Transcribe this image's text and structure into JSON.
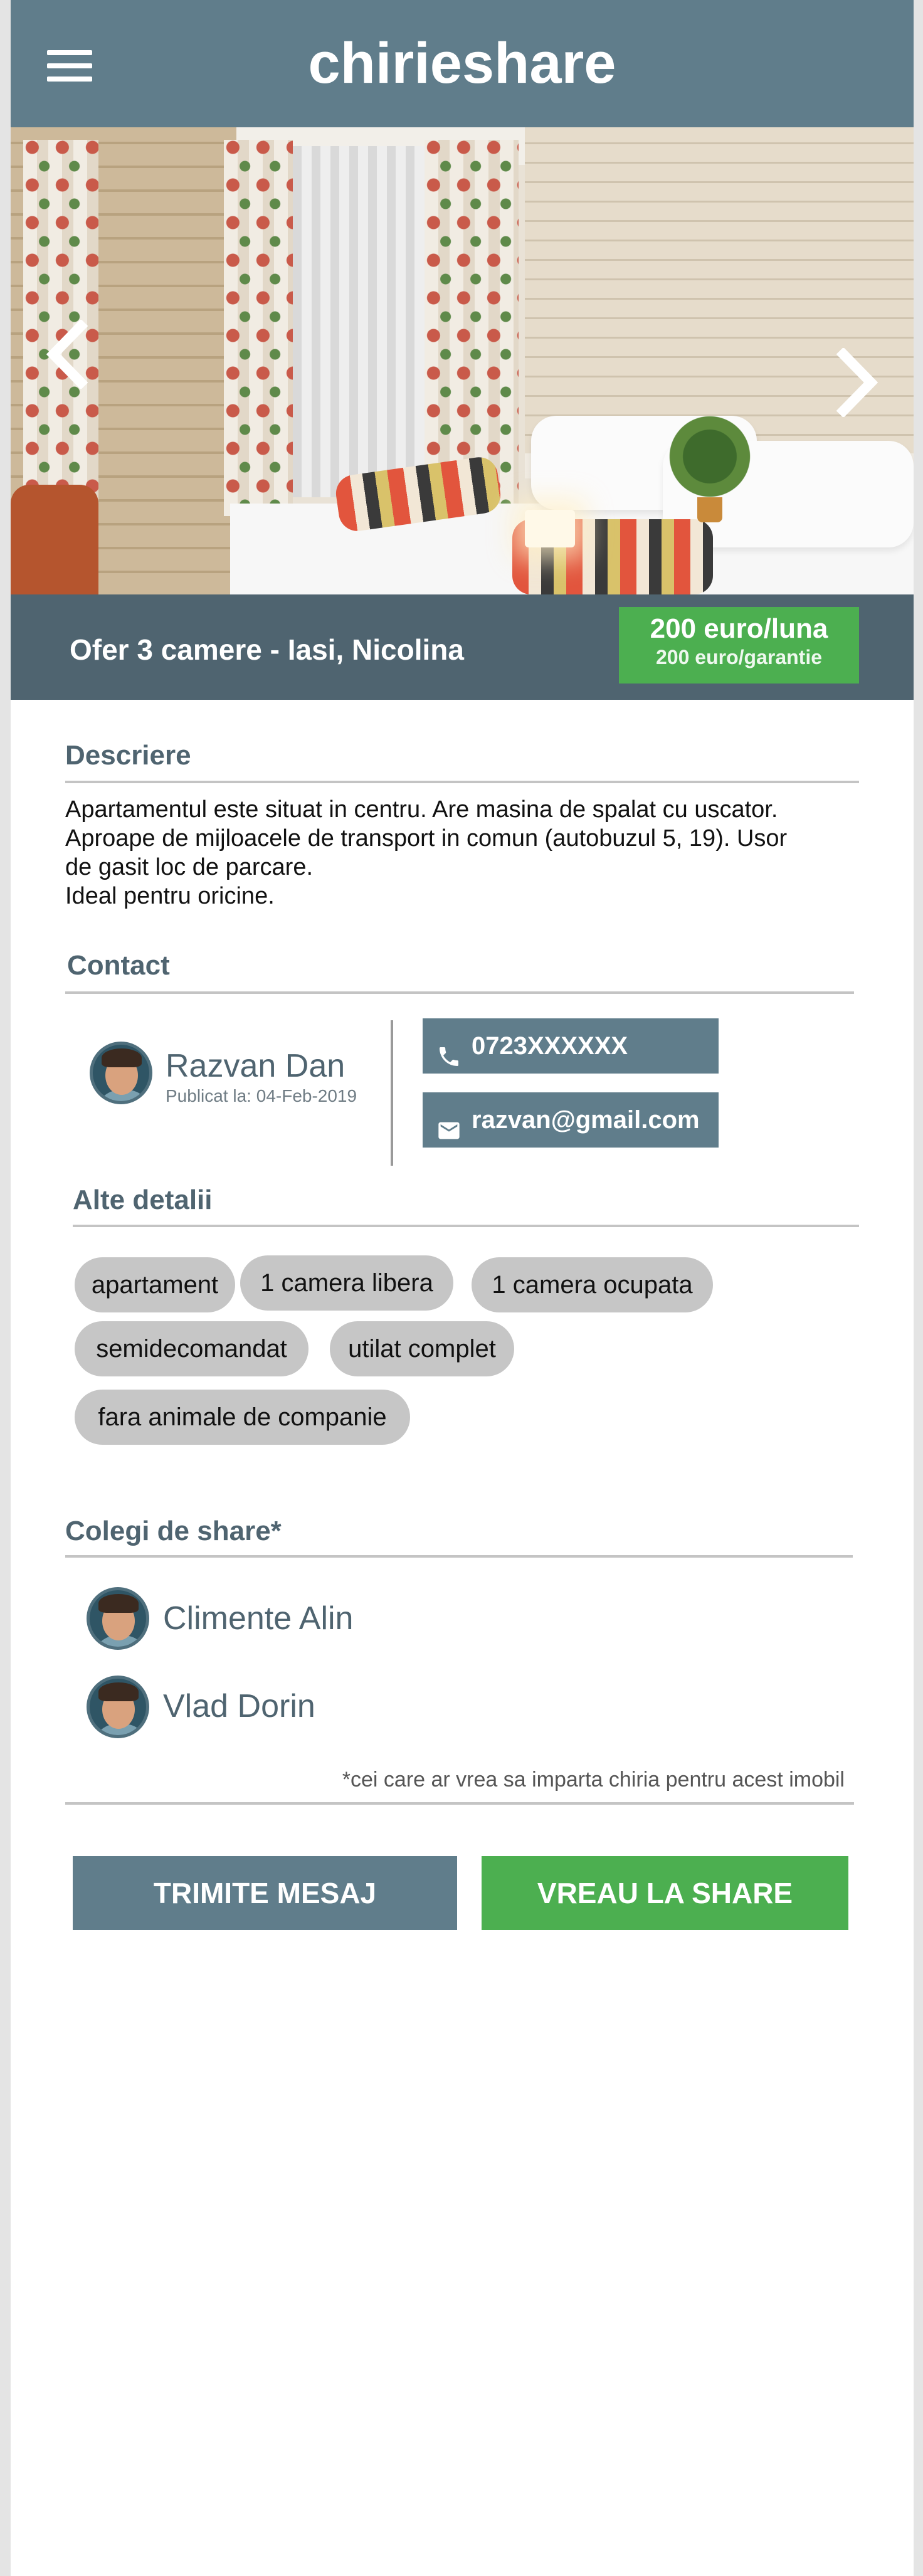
{
  "header": {
    "brand": "chirieshare",
    "menu_icon": "hamburger-menu-icon"
  },
  "gallery": {
    "prev_icon": "chevron-left-icon",
    "next_icon": "chevron-right-icon"
  },
  "listing": {
    "title": "Ofer 3 camere - Iasi, Nicolina",
    "price": "200 euro/luna",
    "deposit": "200 euro/garantie"
  },
  "description": {
    "heading": "Descriere",
    "text": "Apartamentul este situat in centru. Are masina de spalat cu uscator.\nAproape de mijloacele de transport in comun (autobuzul 5, 19). Usor\nde gasit loc de parcare.\nIdeal pentru oricine."
  },
  "contact": {
    "heading": "Contact",
    "name": "Razvan Dan",
    "published": "Publicat la: 04-Feb-2019",
    "phone": "0723XXXXXX",
    "email": "razvan@gmail.com",
    "phone_icon": "phone-icon",
    "email_icon": "email-icon"
  },
  "details": {
    "heading": "Alte detalii",
    "tags": [
      "apartament",
      "1 camera libera",
      "1 camera ocupata",
      "semidecomandat",
      "utilat complet",
      "fara animale de companie"
    ]
  },
  "colleagues": {
    "heading": "Colegi de share*",
    "people": [
      "Climente Alin",
      "Vlad Dorin"
    ],
    "footnote": "*cei care ar vrea sa imparta chiria pentru acest imobil"
  },
  "actions": {
    "message": "TRIMITE MESAJ",
    "share": "VREAU LA SHARE"
  },
  "colors": {
    "primary": "#607d8b",
    "primary_dark": "#4f6470",
    "accent": "#4caf50",
    "chip": "#c6c6c6"
  }
}
